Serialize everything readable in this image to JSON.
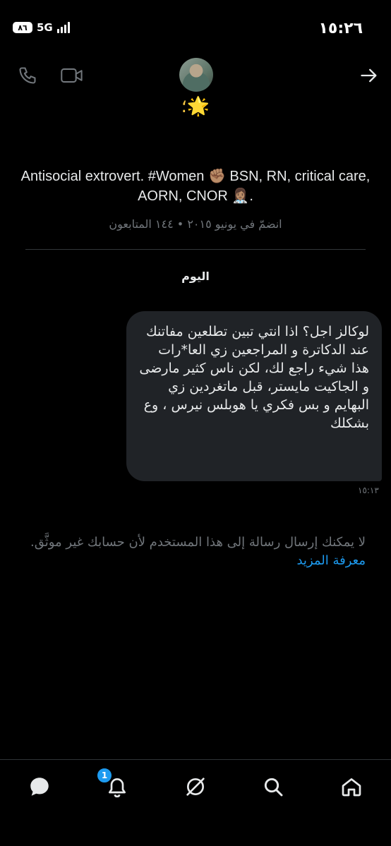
{
  "status_bar": {
    "time": "١٥:٢٦",
    "battery": "٨٦",
    "network": "5G"
  },
  "header": {
    "display_name": "🌟؛",
    "back_icon": "arrow-right-icon",
    "call_icon": "phone-icon",
    "video_icon": "video-camera-icon"
  },
  "profile": {
    "bio": "Antisocial extrovert. #Women ✊🏽 BSN, RN, critical care, AORN, CNOR 👩🏽‍⚕️.",
    "joined": "انضمّ في يونيو ٢٠١٥ • ١٤٤ المتابعون"
  },
  "conversation": {
    "day_label": "اليوم",
    "message": {
      "text": "لوكالز اجل؟ اذا انتي تبين تطلعين مفاتنك عند الدكاترة و المراجعين زي العا*رات هذا شيء راجع لك، لكن ناس كثير مارضى و الجاكيت مايستر، قبل ماتغردين زي البهايم و بس فكري يا هوبلس نيرس ، وع بشكلك",
      "time": "١٥:١٣"
    },
    "notice": "لا يمكنك إرسال رسالة إلى هذا المستخدم لأن حسابك غير موثَّق.",
    "learn_more": "معرفة المزيد"
  },
  "bottom_nav": {
    "notifications_badge": "1",
    "items": [
      "messages-icon",
      "notifications-icon",
      "grok-icon",
      "search-icon",
      "home-icon"
    ]
  },
  "colors": {
    "background": "#000000",
    "bubble": "#202327",
    "accent": "#1d9bf0",
    "muted": "#71767b"
  }
}
